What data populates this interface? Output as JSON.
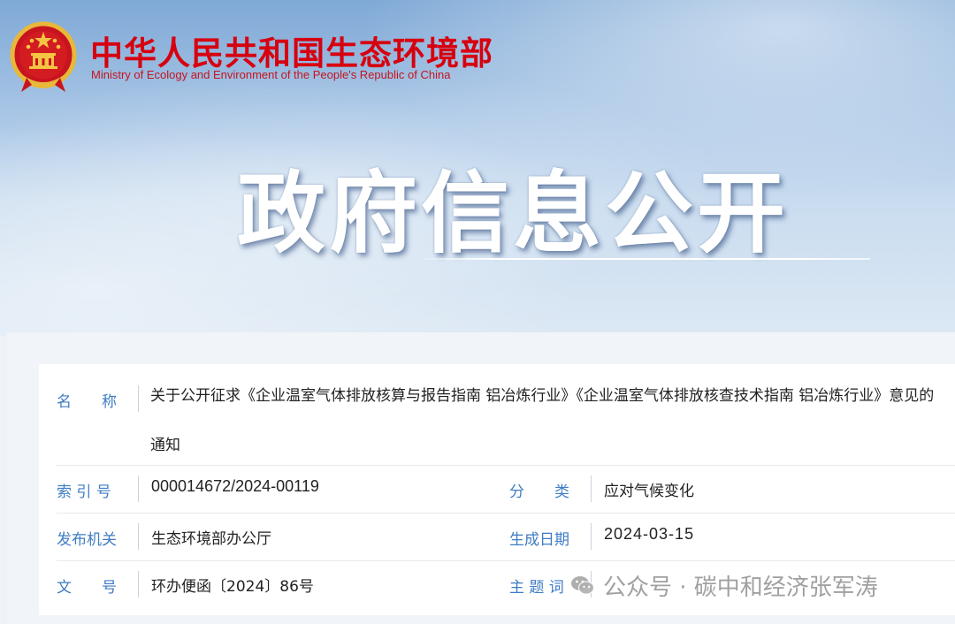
{
  "header": {
    "ministry_cn": "中华人民共和国生态环境部",
    "ministry_en": "Ministry of Ecology and Environment of the People's Republic of China",
    "section_title": "政府信息公开"
  },
  "info": {
    "name_label": "名　　称",
    "name_value": "关于公开征求《企业温室气体排放核算与报告指南 铝冶炼行业》《企业温室气体排放核查技术指南 铝冶炼行业》意见的通知",
    "index_label": "索 引 号",
    "index_value": "000014672/2024-00119",
    "category_label": "分　　类",
    "category_value": "应对气候变化",
    "issuer_label": "发布机关",
    "issuer_value": "生态环境部办公厅",
    "date_label": "生成日期",
    "date_value": "2024-03-15",
    "doc_no_label": "文　　号",
    "doc_no_value": "环办便函〔2024〕86号",
    "keywords_label": "主 题 词",
    "keywords_value": ""
  },
  "watermark": {
    "text": "公众号 · 碳中和经济张军涛",
    "icon": "wechat-icon"
  },
  "colors": {
    "brand_red": "#d7000f",
    "label_blue": "#3f7cc4",
    "text": "#222222"
  }
}
